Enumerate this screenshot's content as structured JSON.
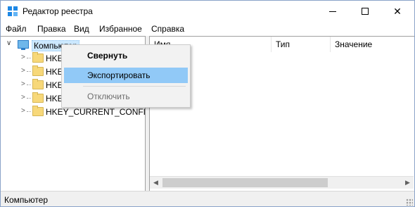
{
  "window": {
    "title": "Редактор реестра"
  },
  "menu": [
    "Файл",
    "Правка",
    "Вид",
    "Избранное",
    "Справка"
  ],
  "tree": {
    "root": "Компьютер",
    "children": [
      "HKE",
      "HKE",
      "HKE",
      "HKE",
      "HKEY_CURRENT_CONFIG"
    ]
  },
  "columns": [
    "Имя",
    "Тип",
    "Значение"
  ],
  "context_menu": {
    "collapse": "Свернуть",
    "export": "Экспортировать",
    "disable": "Отключить"
  },
  "status": "Компьютер"
}
